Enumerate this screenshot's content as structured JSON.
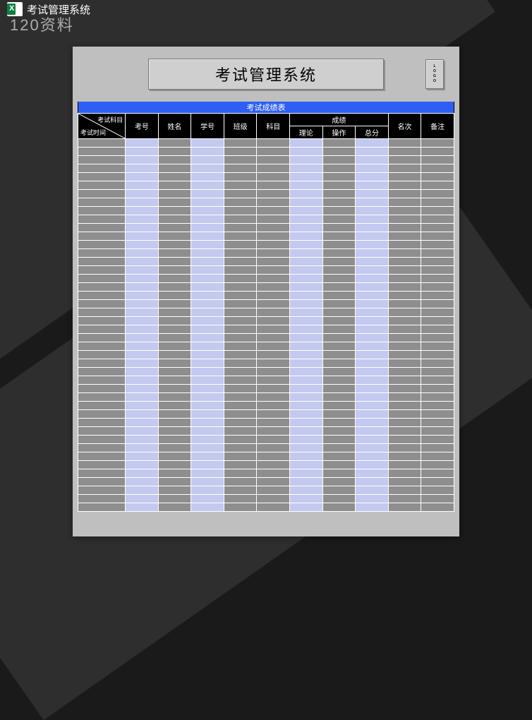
{
  "topbar": {
    "title": "考试管理系统"
  },
  "watermark": "120资料",
  "sheet": {
    "main_title": "考试管理系统",
    "logo": "LOGO",
    "subtitle": "考试成绩表",
    "diag": {
      "top": "考试科目",
      "bottom": "考试时间"
    },
    "cols": {
      "c1": "考号",
      "c2": "姓名",
      "c3": "学号",
      "c4": "班级",
      "c5": "科目",
      "score": "成绩",
      "s1": "理论",
      "s2": "操作",
      "s3": "总分",
      "c6": "名次",
      "c7": "备注"
    },
    "row_count": 44,
    "column_colors": [
      "gray",
      "blue",
      "gray",
      "blue",
      "gray",
      "gray",
      "blue",
      "gray",
      "blue",
      "gray",
      "gray"
    ]
  }
}
